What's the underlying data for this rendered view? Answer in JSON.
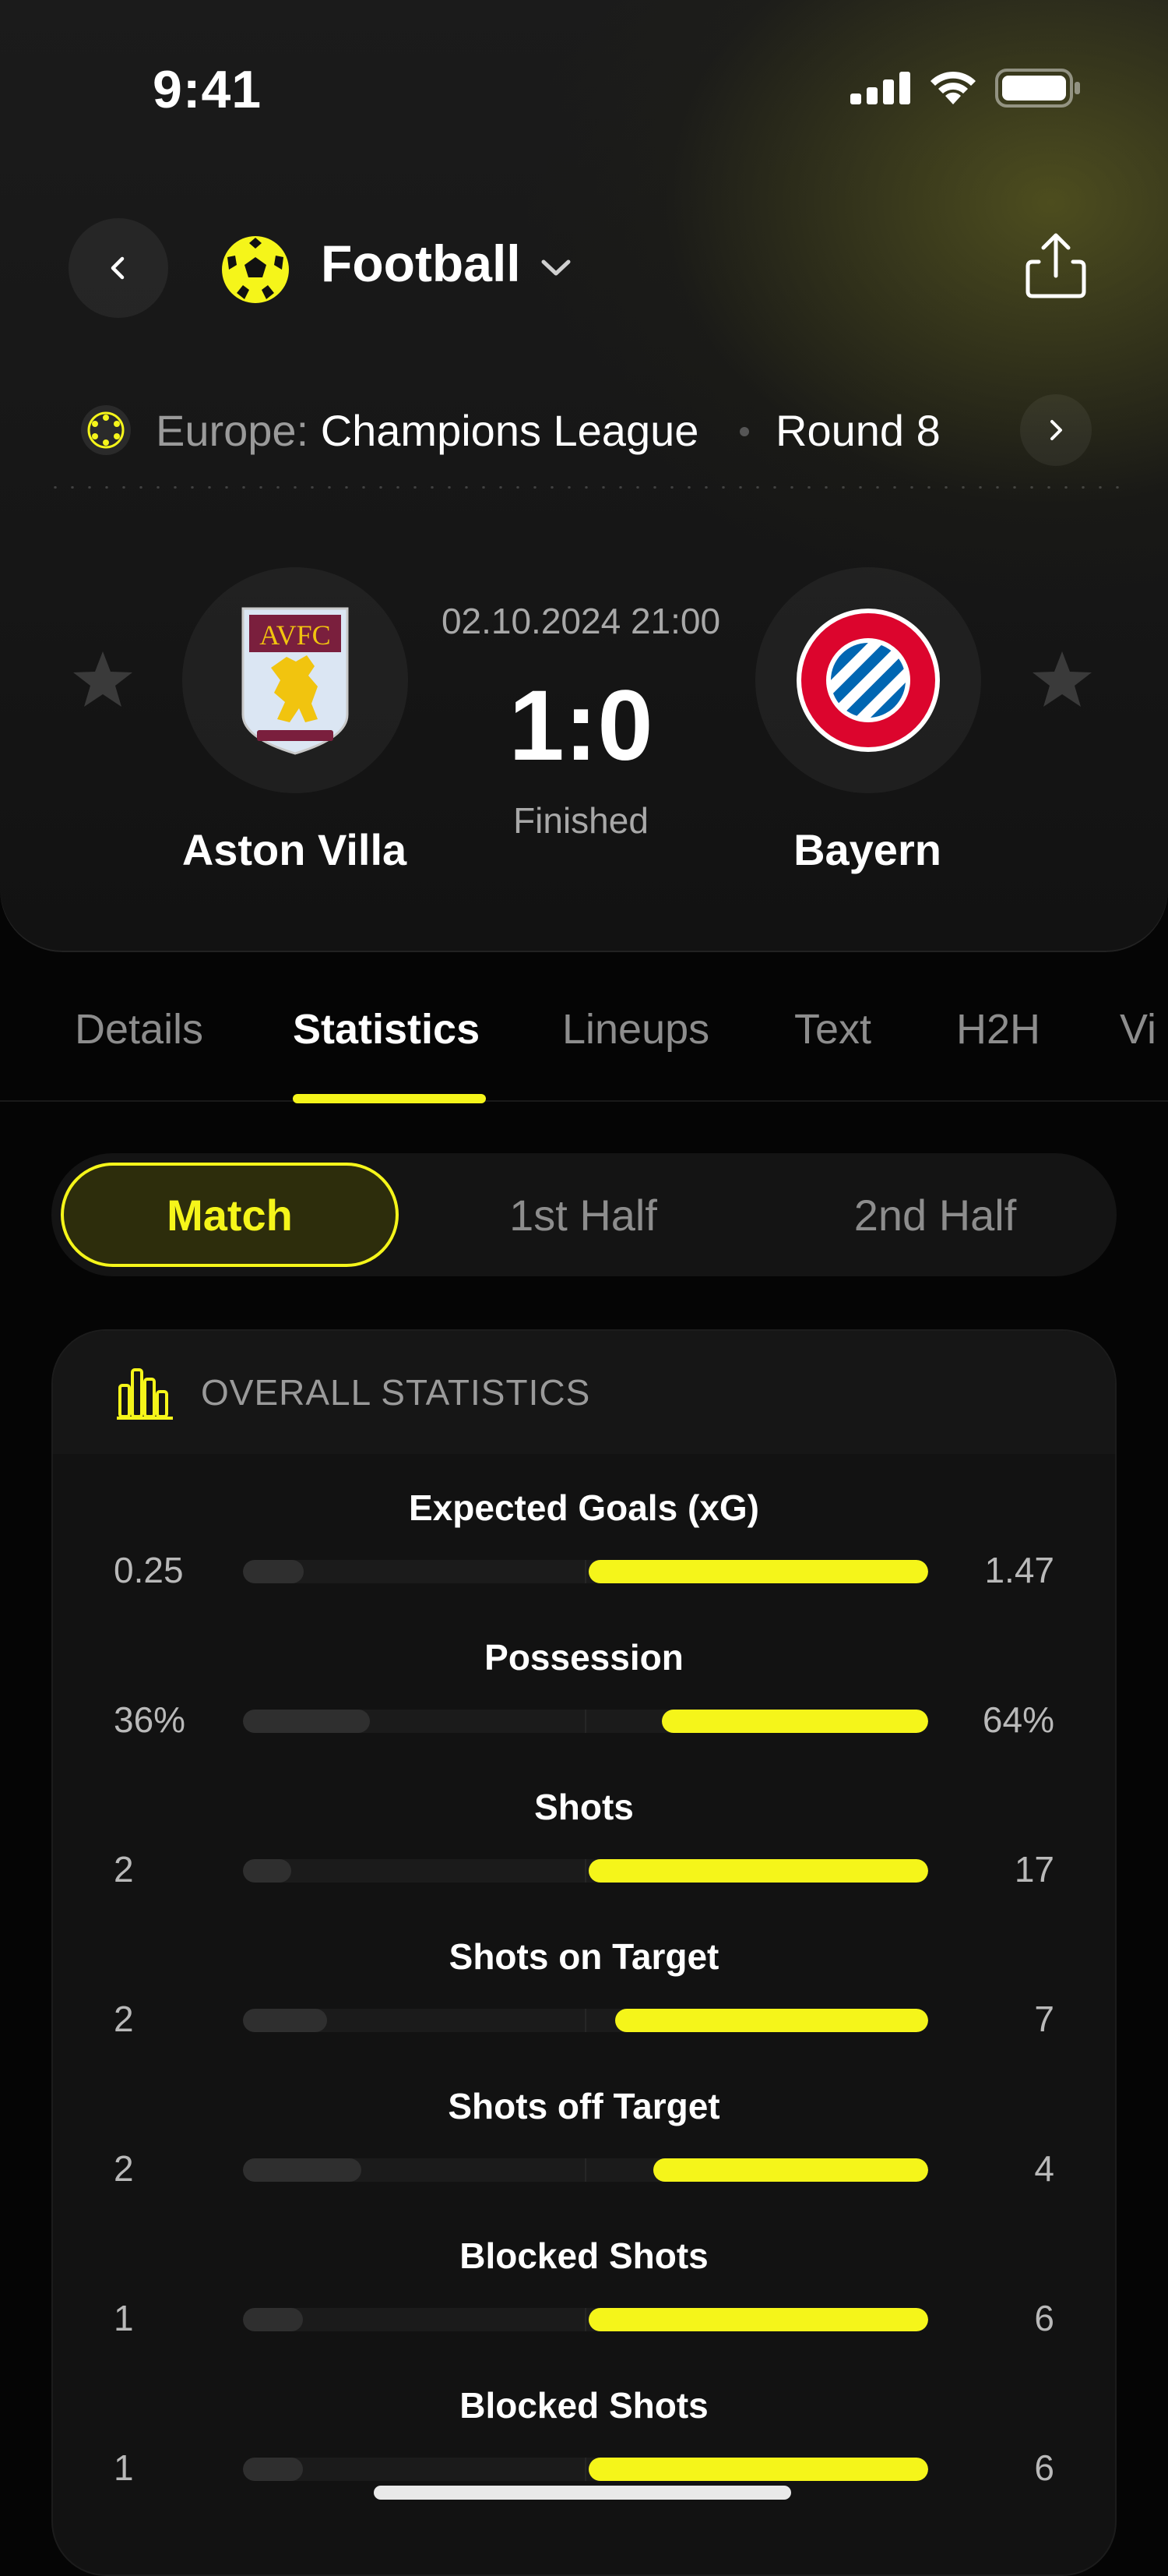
{
  "status_bar": {
    "time": "9:41"
  },
  "header": {
    "sport": "Football",
    "league_region": "Europe:",
    "league_name": "Champions League",
    "round": "Round 8"
  },
  "match": {
    "home_team": "Aston Villa",
    "away_team": "Bayern",
    "datetime": "02.10.2024 21:00",
    "score": "1:0",
    "status": "Finished"
  },
  "tabs": [
    "Details",
    "Statistics",
    "Lineups",
    "Text",
    "H2H",
    "Vi"
  ],
  "active_tab": "Statistics",
  "periods": [
    "Match",
    "1st Half",
    "2nd Half"
  ],
  "active_period": "Match",
  "stats_section": {
    "title": "OVERALL STATISTICS",
    "items": [
      {
        "name": "Expected Goals (xG)",
        "home": "0.25",
        "away": "1.47",
        "home_value": 0.25,
        "away_value": 1.47
      },
      {
        "name": "Possession",
        "home": "36%",
        "away": "64%",
        "home_value": 36,
        "away_value": 64
      },
      {
        "name": "Shots",
        "home": "2",
        "away": "17",
        "home_value": 2,
        "away_value": 17
      },
      {
        "name": "Shots on Target",
        "home": "2",
        "away": "7",
        "home_value": 2,
        "away_value": 7
      },
      {
        "name": "Shots off Target",
        "home": "2",
        "away": "4",
        "home_value": 2,
        "away_value": 4
      },
      {
        "name": "Blocked Shots",
        "home": "1",
        "away": "6",
        "home_value": 1,
        "away_value": 6
      },
      {
        "name": "Blocked Shots",
        "home": "1",
        "away": "6",
        "home_value": 1,
        "away_value": 6
      }
    ]
  },
  "icons": {
    "back": "chevron-left-icon",
    "sport": "soccer-ball-icon",
    "dropdown": "chevron-down-icon",
    "share": "share-icon",
    "league": "champions-league-icon",
    "next": "chevron-right-icon",
    "favorite": "star-icon",
    "stats": "bar-chart-icon"
  },
  "colors": {
    "accent": "#f5f51a",
    "background": "#050505",
    "card": "#121212"
  }
}
